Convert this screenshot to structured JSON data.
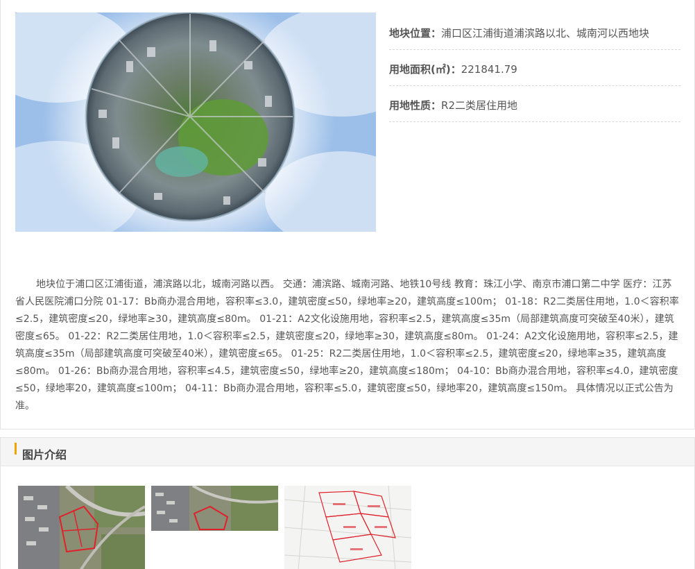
{
  "info": {
    "location_label": "地块位置：",
    "location_value": "浦口区江浦街道浦滨路以北、城南河以西地块",
    "area_label": "用地面积(㎡)：",
    "area_value": "221841.79",
    "nature_label": "用地性质：",
    "nature_value": "R2二类居住用地"
  },
  "description": "地块位于浦口区江浦街道，浦滨路以北，城南河路以西。 交通：浦滨路、城南河路、地铁10号线 教育：珠江小学、南京市浦口第二中学 医疗：江苏省人民医院浦口分院 01-17：Bb商办混合用地，容积率≤3.0，建筑密度≤50，绿地率≥20，建筑高度≤100m； 01-18：R2二类居住用地，1.0＜容积率≤2.5，建筑密度≤20，绿地率≥30，建筑高度≤80m。 01-21：A2文化设施用地，容积率≤2.5，建筑高度≤35m（局部建筑高度可突破至40米），建筑密度≤65。 01-22：R2二类居住用地，1.0＜容积率≤2.5，建筑密度≤20，绿地率≥30，建筑高度≤80m。 01-24：A2文化设施用地，容积率≤2.5，建筑高度≤35m（局部建筑高度可突破至40米），建筑密度≤65。 01-25：R2二类居住用地，1.0＜容积率≤2.5，建筑密度≤20，绿地率≥35，建筑高度≤80m。 01-26：Bb商办混合用地，容积率≤4.5，建筑密度≤50，绿地率≥20，建筑高度≤180m； 04-10：Bb商办混合用地，容积率≤4.0，建筑密度≤50，绿地率20，建筑高度≤100m； 04-11：Bb商办混合用地，容积率≤5.0，建筑密度≤50，绿地率20，建筑高度≤150m。 具体情况以正式公告为准。",
  "gallery": {
    "title": "图片介绍"
  },
  "colors": {
    "accent_bar": "#f0a400",
    "text": "#555555",
    "plot_outline": "#e0202a"
  }
}
